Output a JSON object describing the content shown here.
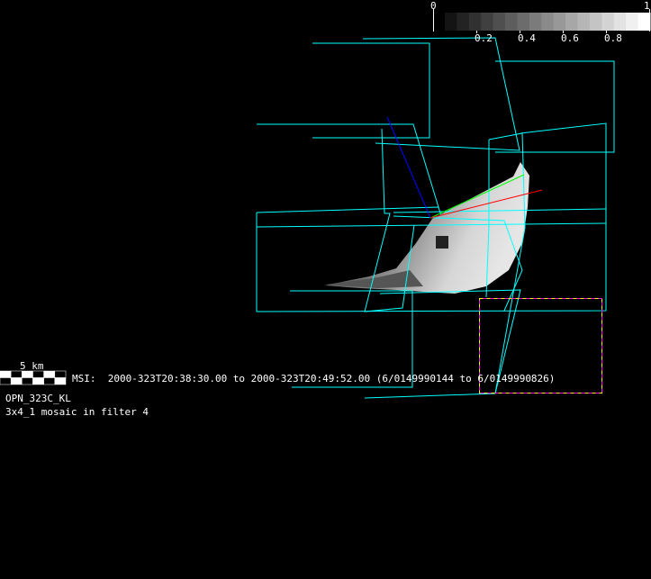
{
  "colorbar": {
    "min_label": "0",
    "max_label": "1",
    "tick_labels": [
      "0.2",
      "0.4",
      "0.6",
      "0.8"
    ],
    "steps": 17
  },
  "scale_bar": {
    "label": "5 km"
  },
  "info": {
    "msi_line": "MSI:  2000-323T20:38:30.00 to 2000-323T20:49:52.00 (6/0149990144 to 6/0149990826)",
    "target_name": "OPN_323C_KL",
    "mosaic_desc": "3x4_1 mosaic in filter 4"
  },
  "colors": {
    "footprint": "#00ffff",
    "highlight_dash_a": "#ff00ff",
    "highlight_dash_b": "#ffff00",
    "axis_x": "#ff0000",
    "axis_y": "#00ff00",
    "axis_z": "#0000ff"
  }
}
